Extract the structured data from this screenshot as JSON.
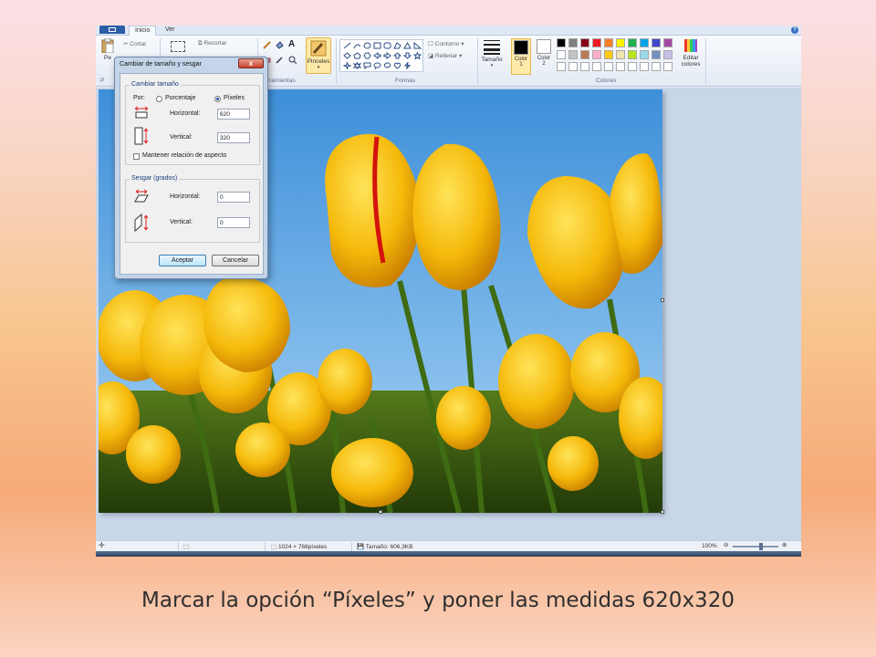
{
  "window": {
    "tabs": [
      {
        "label": "Inicio",
        "active": true
      },
      {
        "label": "Ver",
        "active": false
      }
    ]
  },
  "ribbon": {
    "clipboard": {
      "paste": "Pe",
      "cut": "Cortar",
      "label": "P"
    },
    "image": {
      "crop": "Recortar"
    },
    "tools": {
      "label": "rramientas"
    },
    "brushes": {
      "label": "Pinceles"
    },
    "shapes": {
      "outline": "Contorno",
      "fill": "Rellenar",
      "label": "Formas"
    },
    "size": {
      "label": "Tamaño"
    },
    "color1": {
      "label": "Color",
      "num": "1"
    },
    "color2": {
      "label": "Color",
      "num": "2"
    },
    "palette": {
      "label": "Colores",
      "row1": [
        "#000000",
        "#7f7f7f",
        "#880015",
        "#ed1c24",
        "#ff7f27",
        "#fff200",
        "#22b14c",
        "#00a2e8",
        "#3f48cc",
        "#a349a4"
      ],
      "row2": [
        "#ffffff",
        "#c3c3c3",
        "#b97a57",
        "#ffaec9",
        "#ffc90e",
        "#efe4b0",
        "#b5e61d",
        "#99d9ea",
        "#7092be",
        "#c8bfe7"
      ]
    },
    "edit_colors": {
      "line1": "Editar",
      "line2": "colores"
    }
  },
  "status": {
    "dimensions": "1024 × 768píxeles",
    "size": "Tamaño: 606,3KB",
    "zoom": "100%"
  },
  "dialog": {
    "title": "Cambiar de tamaño y sesgar",
    "close": "x",
    "resize": {
      "legend": "Cambiar tamaño",
      "by_label": "Por:",
      "percent_label": "Porcentaje",
      "pixels_label": "Píxeles",
      "selected": "pixels",
      "horizontal_label": "Horizontal:",
      "horizontal_value": "620",
      "vertical_label": "Vertical:",
      "vertical_value": "320",
      "keep_aspect_label": "Mantener relación de aspecto",
      "keep_aspect_checked": false
    },
    "skew": {
      "legend": "Sesgar (grados)",
      "horizontal_label": "Horizontal:",
      "horizontal_value": "0",
      "vertical_label": "Vertical:",
      "vertical_value": "0"
    },
    "ok": "Aceptar",
    "cancel": "Cancelar"
  },
  "caption": "Marcar la opción “Píxeles” y poner las medidas 620x320"
}
